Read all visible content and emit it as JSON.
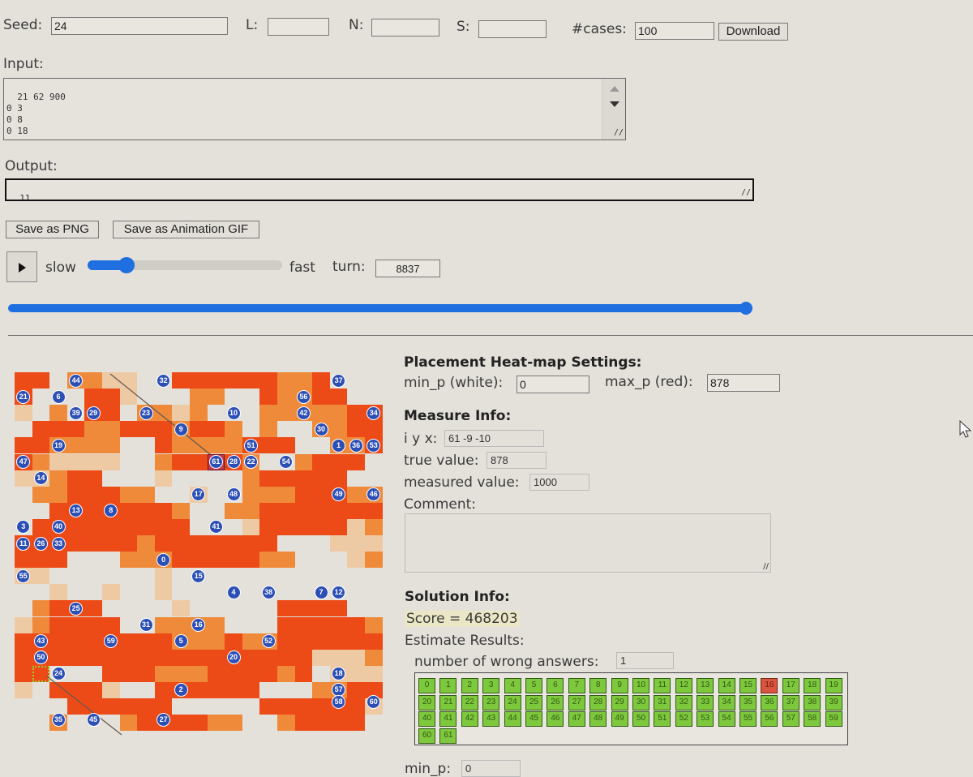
{
  "top": {
    "seed_label": "Seed:",
    "seed_value": "24",
    "l_label": "L:",
    "l_value": "",
    "n_label": "N:",
    "n_value": "",
    "s_label": "S:",
    "s_value": "",
    "cases_label": "#cases:",
    "cases_value": "100",
    "download_label": "Download"
  },
  "input": {
    "label": "Input:",
    "text": "21 62 900\n0 3\n0 8\n0 18"
  },
  "output": {
    "label": "Output:",
    "text": "11"
  },
  "buttons": {
    "save_png": "Save as PNG",
    "save_gif": "Save as Animation GIF"
  },
  "playback": {
    "play_icon": "play-icon",
    "slow_label": "slow",
    "fast_label": "fast",
    "speed_fraction": 0.2,
    "turn_label": "turn:",
    "turn_value": "8837",
    "progress_fraction": 1.0
  },
  "heatmap_settings": {
    "title": "Placement Heat-map Settings:",
    "min_label": "min_p (white):",
    "min_value": "0",
    "max_label": "max_p (red):",
    "max_value": "878"
  },
  "measure": {
    "title": "Measure Info:",
    "iyx_label": "i y x:",
    "iyx_value": "61 -9 -10",
    "true_label": "true value:",
    "true_value": "878",
    "measured_label": "measured value:",
    "measured_value": "1000",
    "comment_label": "Comment:",
    "comment_value": ""
  },
  "solution": {
    "title": "Solution Info:",
    "score_text": "Score = 468203",
    "estimate_label": "Estimate Results:",
    "wrong_label": "number of wrong answers:",
    "wrong_value": "1",
    "results": [
      {
        "id": "0",
        "ok": true
      },
      {
        "id": "1",
        "ok": true
      },
      {
        "id": "2",
        "ok": true
      },
      {
        "id": "3",
        "ok": true
      },
      {
        "id": "4",
        "ok": true
      },
      {
        "id": "5",
        "ok": true
      },
      {
        "id": "6",
        "ok": true
      },
      {
        "id": "7",
        "ok": true
      },
      {
        "id": "8",
        "ok": true
      },
      {
        "id": "9",
        "ok": true
      },
      {
        "id": "10",
        "ok": true
      },
      {
        "id": "11",
        "ok": true
      },
      {
        "id": "12",
        "ok": true
      },
      {
        "id": "13",
        "ok": true
      },
      {
        "id": "14",
        "ok": true
      },
      {
        "id": "15",
        "ok": true
      },
      {
        "id": "16",
        "ok": false
      },
      {
        "id": "17",
        "ok": true
      },
      {
        "id": "18",
        "ok": true
      },
      {
        "id": "19",
        "ok": true
      },
      {
        "id": "20",
        "ok": true
      },
      {
        "id": "21",
        "ok": true
      },
      {
        "id": "22",
        "ok": true
      },
      {
        "id": "23",
        "ok": true
      },
      {
        "id": "24",
        "ok": true
      },
      {
        "id": "25",
        "ok": true
      },
      {
        "id": "26",
        "ok": true
      },
      {
        "id": "27",
        "ok": true
      },
      {
        "id": "28",
        "ok": true
      },
      {
        "id": "29",
        "ok": true
      },
      {
        "id": "30",
        "ok": true
      },
      {
        "id": "31",
        "ok": true
      },
      {
        "id": "32",
        "ok": true
      },
      {
        "id": "33",
        "ok": true
      },
      {
        "id": "34",
        "ok": true
      },
      {
        "id": "35",
        "ok": true
      },
      {
        "id": "36",
        "ok": true
      },
      {
        "id": "37",
        "ok": true
      },
      {
        "id": "38",
        "ok": true
      },
      {
        "id": "39",
        "ok": true
      },
      {
        "id": "40",
        "ok": true
      },
      {
        "id": "41",
        "ok": true
      },
      {
        "id": "42",
        "ok": true
      },
      {
        "id": "43",
        "ok": true
      },
      {
        "id": "44",
        "ok": true
      },
      {
        "id": "45",
        "ok": true
      },
      {
        "id": "46",
        "ok": true
      },
      {
        "id": "47",
        "ok": true
      },
      {
        "id": "48",
        "ok": true
      },
      {
        "id": "49",
        "ok": true
      },
      {
        "id": "50",
        "ok": true
      },
      {
        "id": "51",
        "ok": true
      },
      {
        "id": "52",
        "ok": true
      },
      {
        "id": "53",
        "ok": true
      },
      {
        "id": "54",
        "ok": true
      },
      {
        "id": "55",
        "ok": true
      },
      {
        "id": "56",
        "ok": true
      },
      {
        "id": "57",
        "ok": true
      },
      {
        "id": "58",
        "ok": true
      },
      {
        "id": "59",
        "ok": true
      },
      {
        "id": "60",
        "ok": true
      },
      {
        "id": "61",
        "ok": true
      }
    ],
    "min_p_label": "min_p:",
    "min_p_value": "0"
  },
  "heatmap": {
    "colors": {
      "white": "#e4e1db",
      "light": "#eecaa4",
      "orange": "#ee8a3a",
      "red": "#ec4a16"
    },
    "grid": [
      "330221100333333223000003",
      "300033100022003223300003",
      "102033022120002222233003",
      "033322333233202002233303",
      "332222003222233300223303",
      "321111002333320023330023",
      "112330001000023333300003",
      "022333220010022233322200",
      "003333333200223333333220",
      "033333333300013333312200",
      "333333323333333000111220",
      "333000222333332200012220",
      "110000001000000000000222",
      "001001001000000000000000",
      "023330000100000333300000",
      "123333002222000333332000",
      "333333333222322333333333",
      "333333333333333331112333",
      "330003332223333230111220",
      "103331003333330002233103",
      "000333333000003333331203",
      "002000233332200233330030"
    ],
    "markers": [
      {
        "n": "44",
        "c": 3.5,
        "r": 0.5
      },
      {
        "n": "32",
        "c": 8.5,
        "r": 0.5
      },
      {
        "n": "37",
        "c": 18.5,
        "r": 0.5
      },
      {
        "n": "21",
        "c": 0.5,
        "r": 1.5
      },
      {
        "n": "6",
        "c": 2.5,
        "r": 1.5
      },
      {
        "n": "56",
        "c": 16.5,
        "r": 1.5
      },
      {
        "n": "39",
        "c": 3.5,
        "r": 2.5
      },
      {
        "n": "29",
        "c": 4.5,
        "r": 2.5
      },
      {
        "n": "23",
        "c": 7.5,
        "r": 2.5
      },
      {
        "n": "10",
        "c": 12.5,
        "r": 2.5
      },
      {
        "n": "42",
        "c": 16.5,
        "r": 2.5
      },
      {
        "n": "34",
        "c": 20.5,
        "r": 2.5
      },
      {
        "n": "9",
        "c": 9.5,
        "r": 3.5
      },
      {
        "n": "30",
        "c": 17.5,
        "r": 3.5
      },
      {
        "n": "19",
        "c": 2.5,
        "r": 4.5
      },
      {
        "n": "51",
        "c": 13.5,
        "r": 4.5
      },
      {
        "n": "1",
        "c": 18.5,
        "r": 4.5
      },
      {
        "n": "36",
        "c": 19.5,
        "r": 4.5
      },
      {
        "n": "53",
        "c": 20.5,
        "r": 4.5
      },
      {
        "n": "47",
        "c": 0.5,
        "r": 5.5
      },
      {
        "n": "61",
        "c": 11.5,
        "r": 5.5
      },
      {
        "n": "28",
        "c": 12.5,
        "r": 5.5
      },
      {
        "n": "22",
        "c": 13.5,
        "r": 5.5
      },
      {
        "n": "54",
        "c": 15.5,
        "r": 5.5
      },
      {
        "n": "14",
        "c": 1.5,
        "r": 6.5
      },
      {
        "n": "17",
        "c": 10.5,
        "r": 7.5
      },
      {
        "n": "48",
        "c": 12.5,
        "r": 7.5
      },
      {
        "n": "49",
        "c": 18.5,
        "r": 7.5
      },
      {
        "n": "46",
        "c": 20.5,
        "r": 7.5
      },
      {
        "n": "13",
        "c": 3.5,
        "r": 8.5
      },
      {
        "n": "8",
        "c": 5.5,
        "r": 8.5
      },
      {
        "n": "3",
        "c": 0.5,
        "r": 9.5
      },
      {
        "n": "40",
        "c": 2.5,
        "r": 9.5
      },
      {
        "n": "41",
        "c": 11.5,
        "r": 9.5
      },
      {
        "n": "11",
        "c": 0.5,
        "r": 10.5
      },
      {
        "n": "26",
        "c": 1.5,
        "r": 10.5
      },
      {
        "n": "33",
        "c": 2.5,
        "r": 10.5
      },
      {
        "n": "0",
        "c": 8.5,
        "r": 11.5
      },
      {
        "n": "55",
        "c": 0.5,
        "r": 12.5
      },
      {
        "n": "15",
        "c": 10.5,
        "r": 12.5
      },
      {
        "n": "4",
        "c": 12.5,
        "r": 13.5
      },
      {
        "n": "38",
        "c": 14.5,
        "r": 13.5
      },
      {
        "n": "7",
        "c": 17.5,
        "r": 13.5
      },
      {
        "n": "12",
        "c": 18.5,
        "r": 13.5
      },
      {
        "n": "25",
        "c": 3.5,
        "r": 14.5
      },
      {
        "n": "31",
        "c": 7.5,
        "r": 15.5
      },
      {
        "n": "16",
        "c": 10.5,
        "r": 15.5
      },
      {
        "n": "43",
        "c": 1.5,
        "r": 16.5
      },
      {
        "n": "59",
        "c": 5.5,
        "r": 16.5
      },
      {
        "n": "5",
        "c": 9.5,
        "r": 16.5
      },
      {
        "n": "52",
        "c": 14.5,
        "r": 16.5
      },
      {
        "n": "50",
        "c": 1.5,
        "r": 17.5
      },
      {
        "n": "20",
        "c": 12.5,
        "r": 17.5
      },
      {
        "n": "24",
        "c": 2.5,
        "r": 18.5
      },
      {
        "n": "18",
        "c": 18.5,
        "r": 18.5
      },
      {
        "n": "2",
        "c": 9.5,
        "r": 19.5
      },
      {
        "n": "57",
        "c": 18.5,
        "r": 19.5
      },
      {
        "n": "58",
        "c": 18.5,
        "r": 20.2
      },
      {
        "n": "60",
        "c": 20.5,
        "r": 20.2
      },
      {
        "n": "35",
        "c": 2.5,
        "r": 21.3
      },
      {
        "n": "45",
        "c": 4.5,
        "r": 21.3
      },
      {
        "n": "27",
        "c": 8.5,
        "r": 21.3
      }
    ],
    "selected_marker": "61",
    "highlight_cell_marker": "24"
  }
}
